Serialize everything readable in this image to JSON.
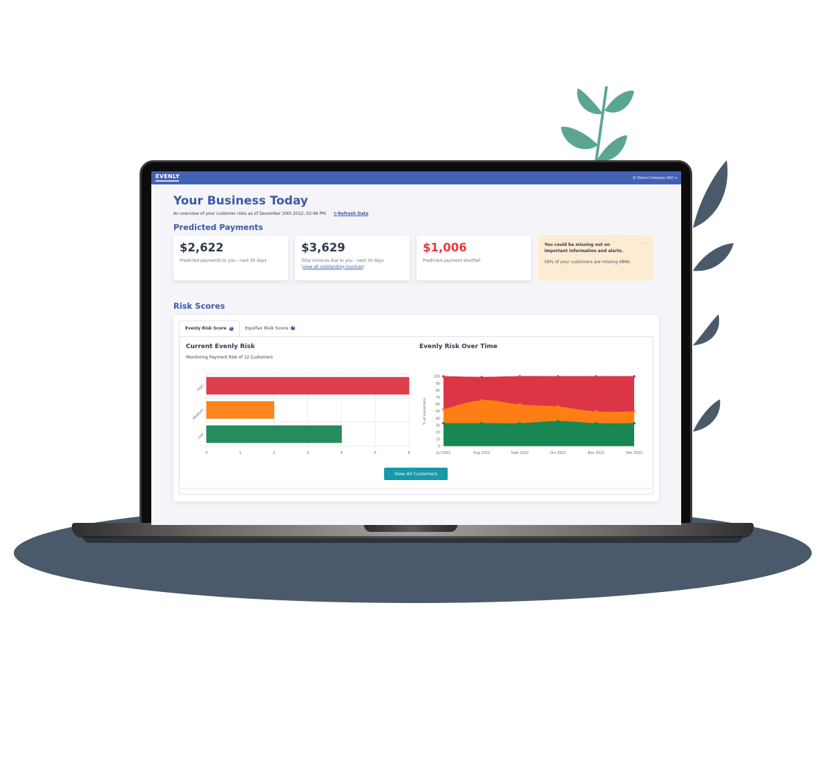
{
  "app": {
    "logo": "EVENLY",
    "company": "Demo Company (AU)"
  },
  "page": {
    "title": "Your Business Today",
    "subtitle": "An overview of your customer risks as of December 20th 2022, 02:46 PM.",
    "refresh_label": "Refresh Data"
  },
  "predicted_payments": {
    "title": "Predicted Payments",
    "cards": [
      {
        "amount": "$2,622",
        "desc": "Predicted payments to you - next 30 days"
      },
      {
        "amount": "$3,629",
        "desc": "Total invoices due to you - next 30 days",
        "link": "view all outstanding invoices"
      },
      {
        "amount": "$1,006",
        "desc": "Predicted payment shortfall",
        "color": "#e8383d"
      }
    ],
    "alert": {
      "title": "You could be missing out on important information and alerts.",
      "text": "58% of your customers are missing ABNs"
    }
  },
  "risk_scores": {
    "title": "Risk Scores",
    "tabs": [
      {
        "label": "Evenly Risk Score",
        "active": true
      },
      {
        "label": "Equifax Risk Score",
        "active": false
      }
    ],
    "current_title": "Current Evenly Risk",
    "current_subtitle": "Monitoring Payment Risk of 12 Customers",
    "over_time_title": "Evenly Risk Over Time",
    "view_all_label": "View All Customers"
  },
  "colors": {
    "brand": "#4361b3",
    "high": "#dc3545",
    "medium": "#fd7e14",
    "low": "#198754",
    "button": "#1899a8"
  },
  "chart_data": [
    {
      "type": "bar",
      "orientation": "horizontal",
      "title": "Current Evenly Risk",
      "categories": [
        "High",
        "Medium",
        "Low"
      ],
      "values": [
        6,
        2,
        4
      ],
      "xlim": [
        0,
        6
      ],
      "xticks": [
        0,
        1,
        2,
        3,
        4,
        5,
        6
      ],
      "grid": true
    },
    {
      "type": "area",
      "stacked": true,
      "title": "Evenly Risk Over Time",
      "ylabel": "% of customers",
      "x": [
        "Jul 2022",
        "Aug 2022",
        "Sept 2022",
        "Oct 2022",
        "Nov 2022",
        "Dec 2022"
      ],
      "ylim": [
        0,
        100
      ],
      "yticks": [
        0,
        10,
        20,
        30,
        40,
        50,
        60,
        70,
        80,
        90,
        100
      ],
      "series": [
        {
          "name": "Low",
          "values": [
            33,
            33,
            33,
            36,
            33,
            33
          ]
        },
        {
          "name": "Medium",
          "values": [
            20,
            33,
            27,
            21,
            17,
            17
          ]
        },
        {
          "name": "High",
          "values": [
            47,
            33,
            40,
            43,
            50,
            50
          ]
        }
      ]
    }
  ]
}
